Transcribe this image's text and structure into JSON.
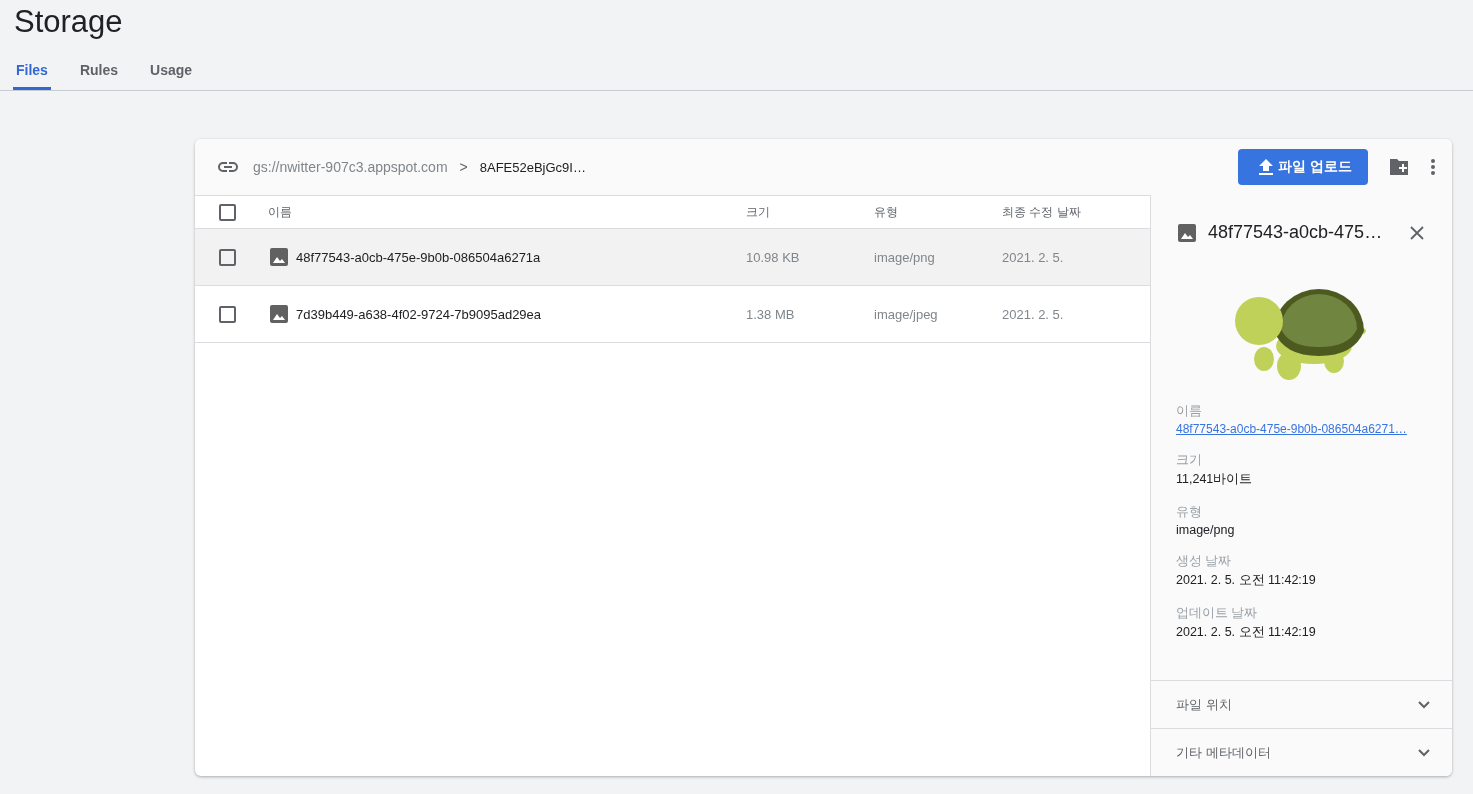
{
  "page": {
    "title": "Storage"
  },
  "tabs": [
    {
      "label": "Files",
      "selected": true
    },
    {
      "label": "Rules",
      "selected": false
    },
    {
      "label": "Usage",
      "selected": false
    }
  ],
  "breadcrumb": {
    "bucket": "gs://nwitter-907c3.appspot.com",
    "separator": ">",
    "folder": "8AFE52eBjGc9I…"
  },
  "toolbar": {
    "upload_button": "파일 업로드"
  },
  "table": {
    "columns": [
      "이름",
      "크기",
      "유형",
      "최종 수정 날짜"
    ],
    "header_checked": false,
    "rows": [
      {
        "name": "48f77543-a0cb-475e-9b0b-086504a6271a",
        "size": "10.98 KB",
        "type": "image/png",
        "modified": "2021. 2. 5.",
        "checked": false,
        "selected": true
      },
      {
        "name": "7d39b449-a638-4f02-9724-7b9095ad29ea",
        "size": "1.38 MB",
        "type": "image/jpeg",
        "modified": "2021. 2. 5.",
        "checked": false,
        "selected": false
      }
    ]
  },
  "details": {
    "title": "48f77543-a0cb-475…",
    "fields": [
      {
        "label": "이름",
        "value": "48f77543-a0cb-475e-9b0b-086504a6271…",
        "kind": "link"
      },
      {
        "label": "크기",
        "value": "11,241바이트",
        "kind": "text"
      },
      {
        "label": "유형",
        "value": "image/png",
        "kind": "text"
      },
      {
        "label": "생성 날짜",
        "value": "2021. 2. 5. 오전 11:42:19",
        "kind": "text"
      },
      {
        "label": "업데이트 날짜",
        "value": "2021. 2. 5. 오전 11:42:19",
        "kind": "text"
      }
    ],
    "sections": [
      {
        "label": "파일 위치",
        "expanded": false
      },
      {
        "label": "기타 메타데이터",
        "expanded": false
      }
    ]
  }
}
